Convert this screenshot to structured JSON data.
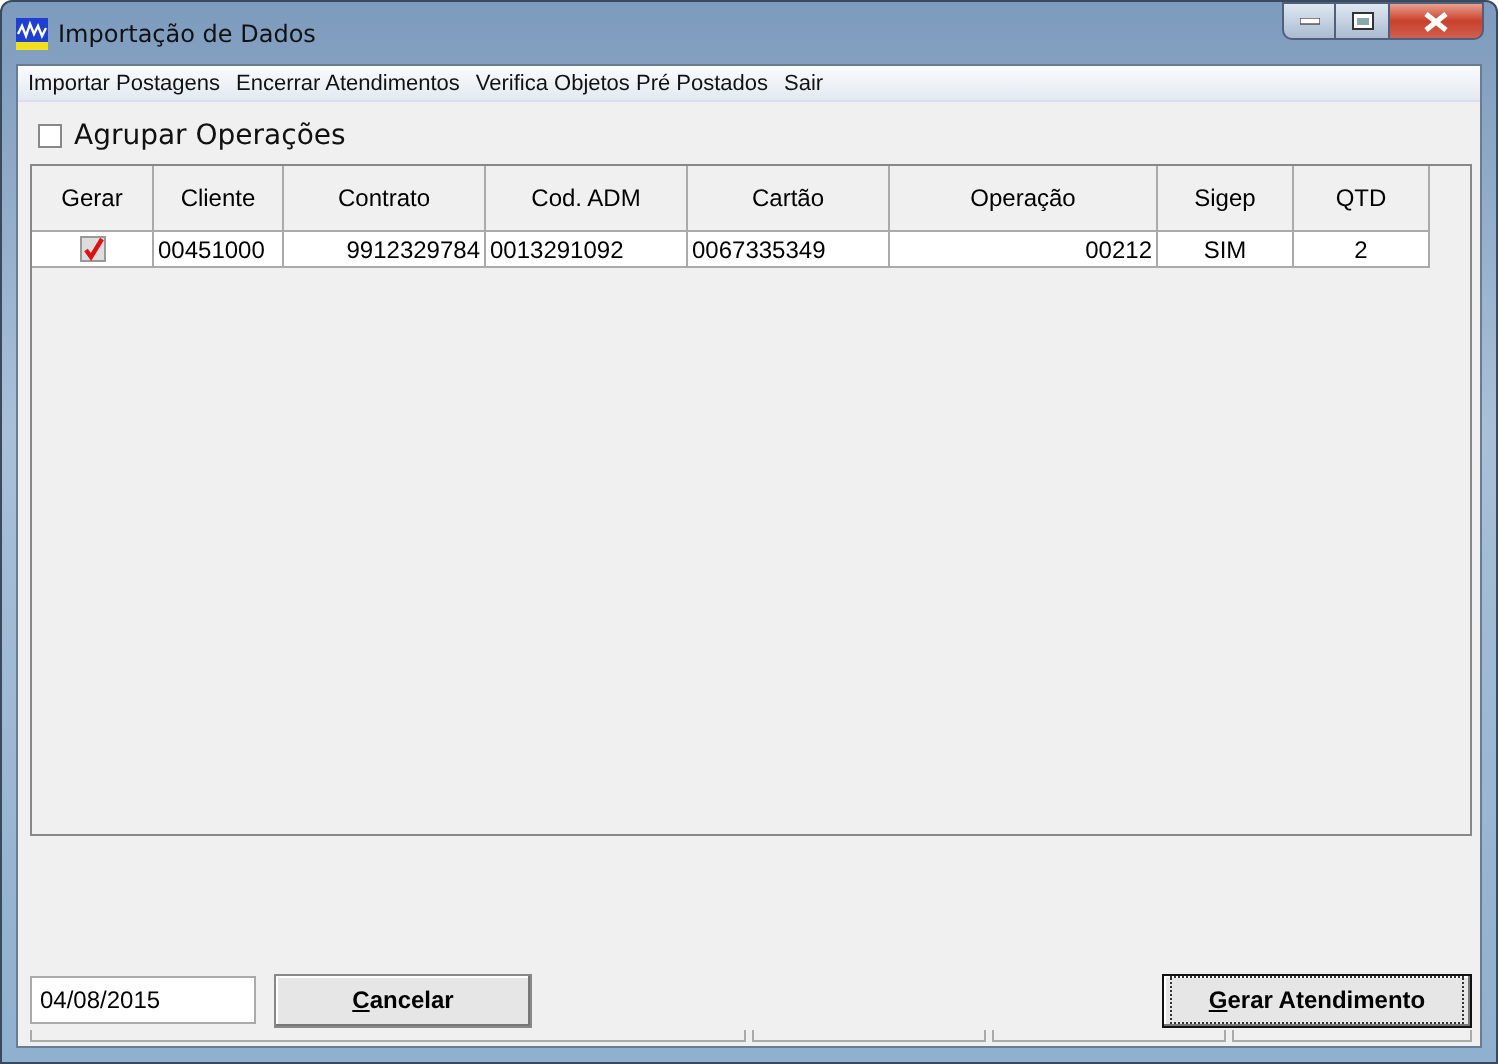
{
  "window": {
    "title": "Importação de Dados"
  },
  "menu": [
    "Importar Postagens",
    "Encerrar Atendimentos",
    "Verifica Objetos Pré Postados",
    "Sair"
  ],
  "group_option": {
    "label": "Agrupar Operações",
    "checked": false
  },
  "table": {
    "columns": [
      "Gerar",
      "Cliente",
      "Contrato",
      "Cod. ADM",
      "Cartão",
      "Operação",
      "Sigep",
      "QTD"
    ],
    "rows": [
      {
        "cells": [
          {
            "kind": "checkbox",
            "checked": true
          },
          {
            "kind": "text",
            "value": "00451000"
          },
          {
            "kind": "text",
            "value": "9912329784"
          },
          {
            "kind": "text",
            "value": "0013291092"
          },
          {
            "kind": "text",
            "value": "0067335349"
          },
          {
            "kind": "text",
            "value": "00212"
          },
          {
            "kind": "text",
            "value": "SIM"
          },
          {
            "kind": "text",
            "value": "2"
          }
        ]
      }
    ]
  },
  "date_field": {
    "value": "04/08/2015"
  },
  "buttons": [
    {
      "label": "Cancelar",
      "default": false
    },
    {
      "label": "Gerar Atendimento",
      "default": true
    }
  ]
}
